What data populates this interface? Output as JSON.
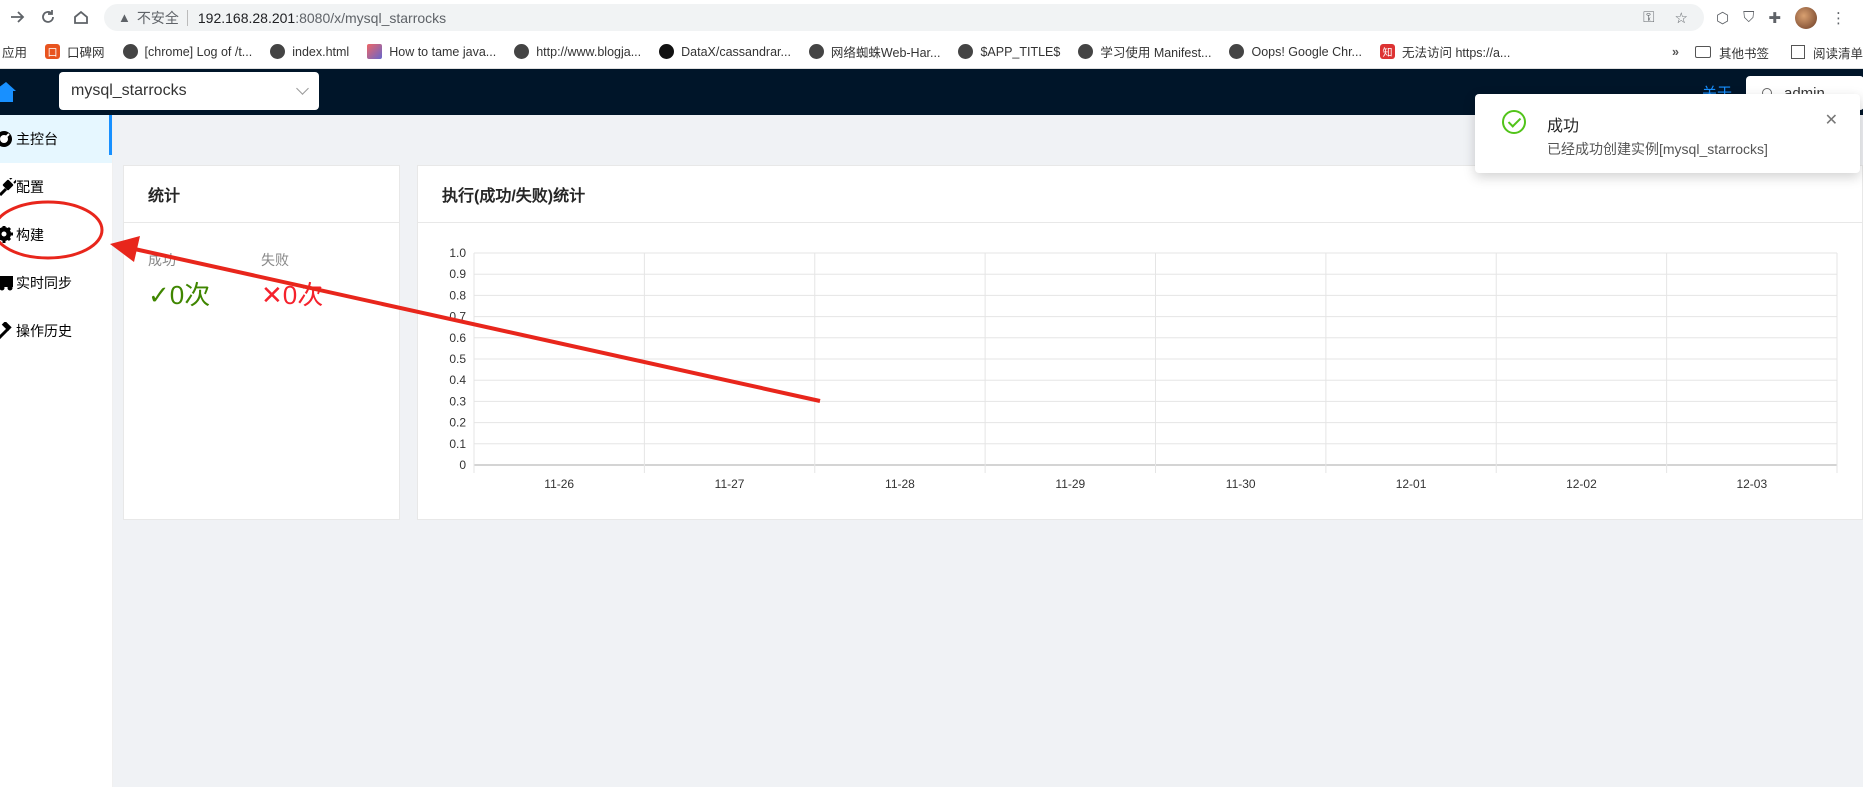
{
  "browser": {
    "insecure_label": "不安全",
    "url_host": "192.168.28.201",
    "url_path": ":8080/x/mysql_starrocks",
    "bookmarks": [
      "应用",
      "口碑网",
      "[chrome] Log of /t...",
      "index.html",
      "How to tame java...",
      "http://www.blogja...",
      "DataX/cassandrar...",
      "网络蜘蛛Web-Har...",
      "$APP_TITLE$",
      "学习使用 Manifest...",
      "Oops! Google Chr...",
      "无法访问 https://a..."
    ],
    "other_bookmarks": "其他书签",
    "reading_list": "阅读清单"
  },
  "header": {
    "instance_selected": "mysql_starrocks",
    "link_label": "关于",
    "user": "admin"
  },
  "sidebar": {
    "items": [
      {
        "label": "主控台",
        "icon": "dashboard-icon"
      },
      {
        "label": "配置",
        "icon": "plug-icon"
      },
      {
        "label": "构建",
        "icon": "cog-icon"
      },
      {
        "label": "实时同步",
        "icon": "truck-icon"
      },
      {
        "label": "操作历史",
        "icon": "hammer-icon"
      }
    ]
  },
  "stats": {
    "title": "统计",
    "success_label": "成功",
    "success_value": "✓0次",
    "fail_label": "失败",
    "fail_value": "✕0次"
  },
  "chart_card": {
    "title": "执行(成功/失败)统计"
  },
  "chart_data": {
    "type": "bar",
    "categories": [
      "11-26",
      "11-27",
      "11-28",
      "11-29",
      "11-30",
      "12-01",
      "12-02",
      "12-03"
    ],
    "series": [
      {
        "values": [
          0,
          0,
          0,
          0,
          0,
          0,
          0,
          0
        ]
      }
    ],
    "yticks": [
      "0",
      "0.1",
      "0.2",
      "0.3",
      "0.4",
      "0.5",
      "0.6",
      "0.7",
      "0.8",
      "0.9",
      "1.0"
    ],
    "ylim": [
      0,
      1
    ],
    "grid": true,
    "title": "",
    "xlabel": "",
    "ylabel": ""
  },
  "notification": {
    "title": "成功",
    "message": "已经成功创建实例[mysql_starrocks]",
    "close_symbol": "✕",
    "success_color": "#52c41a"
  },
  "colors": {
    "header_bg": "#001529",
    "primary": "#1890ff",
    "annotation": "#e8261c"
  }
}
